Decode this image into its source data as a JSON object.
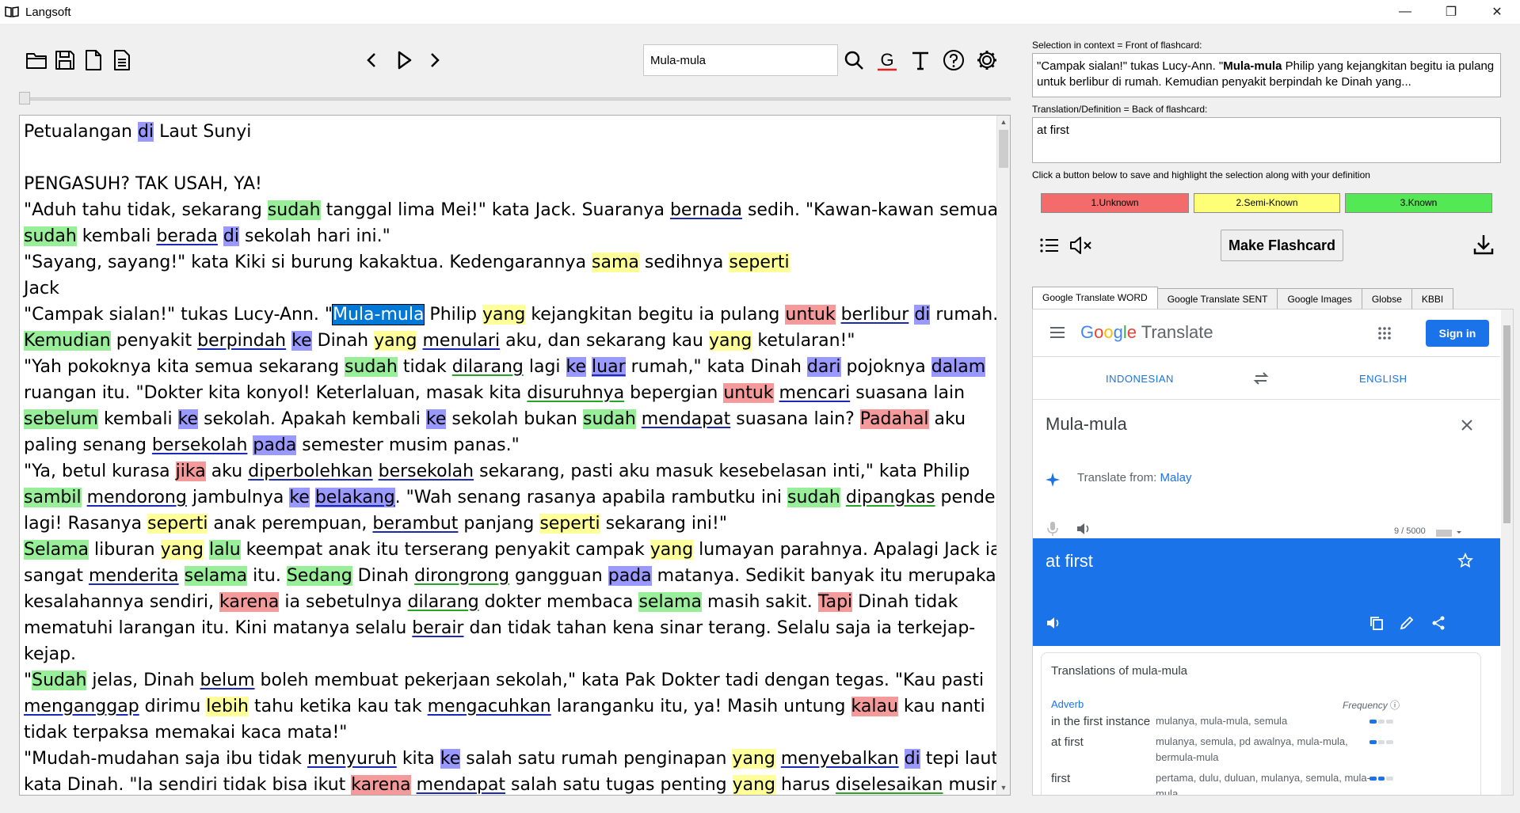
{
  "window": {
    "title": "Langsoft",
    "minimize": "—",
    "restore": "❐",
    "close": "✕"
  },
  "search": {
    "value": "Mula-mula"
  },
  "reader": {
    "lines": [
      [
        [
          "Petualangan ",
          ""
        ],
        [
          "di",
          "b"
        ],
        [
          " Laut Sunyi",
          ""
        ]
      ],
      [
        [
          "",
          ""
        ]
      ],
      [
        [
          "PENGASUH?  TAK USAH, YA!",
          ""
        ]
      ],
      [
        [
          " \"Aduh  tahu tidak, sekarang ",
          ""
        ],
        [
          "sudah",
          "k"
        ],
        [
          " tanggal lima Mei!\" kata Jack. Suaranya ",
          ""
        ],
        [
          "bernada",
          "ul"
        ],
        [
          "  sedih. \"Kawan-kawan semua",
          ""
        ]
      ],
      [
        [
          "sudah",
          "k"
        ],
        [
          " kembali ",
          ""
        ],
        [
          "berada",
          "ul"
        ],
        [
          " ",
          ""
        ],
        [
          "di",
          "b"
        ],
        [
          " sekolah hari ini.\"",
          ""
        ]
      ],
      [
        [
          "\"Sayang, sayang!\" kata Kiki si burung kakaktua. Kedengarannya ",
          ""
        ],
        [
          "sama",
          "s"
        ],
        [
          " sedihnya ",
          ""
        ],
        [
          "seperti",
          "s"
        ]
      ],
      [
        [
          "Jack",
          ""
        ]
      ],
      [
        [
          "\"Campak sialan!\" tukas Lucy-Ann. \"",
          ""
        ],
        [
          "Mula-mula",
          "sel"
        ],
        [
          " Philip ",
          ""
        ],
        [
          "yang",
          "s"
        ],
        [
          " kejangkitan begitu ia pulang ",
          ""
        ],
        [
          "untuk",
          "u"
        ],
        [
          " ",
          ""
        ],
        [
          "berlibur",
          "ul"
        ],
        [
          " ",
          ""
        ],
        [
          "di",
          "b"
        ],
        [
          " rumah.",
          ""
        ]
      ],
      [
        [
          "Kemudian",
          "k"
        ],
        [
          " penyakit ",
          ""
        ],
        [
          "berpindah",
          "ul"
        ],
        [
          " ",
          ""
        ],
        [
          "ke",
          "b"
        ],
        [
          " Dinah ",
          ""
        ],
        [
          "yang",
          "s"
        ],
        [
          " ",
          ""
        ],
        [
          "menulari",
          "ul"
        ],
        [
          " aku, dan sekarang kau ",
          ""
        ],
        [
          "yang",
          "s"
        ],
        [
          " ketularan!\"",
          ""
        ]
      ],
      [
        [
          "\"Yah  pokoknya kita semua sekarang ",
          ""
        ],
        [
          "sudah",
          "k"
        ],
        [
          " tidak ",
          ""
        ],
        [
          "dilarang",
          "ulg"
        ],
        [
          " lagi ",
          ""
        ],
        [
          "ke",
          "b"
        ],
        [
          " ",
          ""
        ],
        [
          "luar",
          "b ul"
        ],
        [
          " rumah,\" kata  Dinah ",
          ""
        ],
        [
          "dari",
          "b"
        ],
        [
          " pojoknya ",
          ""
        ],
        [
          "dalam",
          "b"
        ]
      ],
      [
        [
          "ruangan itu. \"Dokter kita konyol! Keterlaluan, masak kita ",
          ""
        ],
        [
          "disuruhnya",
          "ulg"
        ],
        [
          " bepergian ",
          ""
        ],
        [
          "untuk",
          "u"
        ],
        [
          " ",
          ""
        ],
        [
          "mencari",
          "ul"
        ],
        [
          " suasana lain",
          ""
        ]
      ],
      [
        [
          "sebelum",
          "k"
        ],
        [
          " kembali ",
          ""
        ],
        [
          "ke",
          "b"
        ],
        [
          " sekolah. Apakah kembali ",
          ""
        ],
        [
          "ke",
          "b"
        ],
        [
          " sekolah bukan ",
          ""
        ],
        [
          "sudah",
          "k"
        ],
        [
          " ",
          ""
        ],
        [
          "mendapat",
          "ul"
        ],
        [
          " suasana lain? ",
          ""
        ],
        [
          "Padahal",
          "u"
        ],
        [
          " aku",
          ""
        ]
      ],
      [
        [
          "paling senang ",
          ""
        ],
        [
          "bersekolah",
          "ul"
        ],
        [
          " ",
          ""
        ],
        [
          "pada",
          "b"
        ],
        [
          " semester musim panas.\"",
          ""
        ]
      ],
      [
        [
          "\"Ya, betul kurasa ",
          ""
        ],
        [
          "jika",
          "u"
        ],
        [
          " aku ",
          ""
        ],
        [
          "diperbolehkan",
          "ul"
        ],
        [
          " ",
          ""
        ],
        [
          "bersekolah",
          "ul"
        ],
        [
          " sekarang, pasti aku masuk  kesebelasan inti,\" kata Philip",
          ""
        ]
      ],
      [
        [
          "sambil",
          "k"
        ],
        [
          " ",
          ""
        ],
        [
          "mendorong",
          "ul"
        ],
        [
          " jambulnya ",
          ""
        ],
        [
          "ke",
          "b"
        ],
        [
          " ",
          ""
        ],
        [
          "belakang",
          "b ul"
        ],
        [
          ". \"Wah senang  rasanya apabila rambutku ini ",
          ""
        ],
        [
          "sudah",
          "k"
        ],
        [
          " ",
          ""
        ],
        [
          "dipangkas",
          "ulg"
        ],
        [
          " pendek",
          ""
        ]
      ],
      [
        [
          "lagi! Rasanya ",
          ""
        ],
        [
          "seperti",
          "s"
        ],
        [
          " anak perempuan, ",
          ""
        ],
        [
          "berambut",
          "ul"
        ],
        [
          " panjang ",
          ""
        ],
        [
          "seperti",
          "s"
        ],
        [
          " sekarang ini!\"",
          ""
        ]
      ],
      [
        [
          "Selama",
          "k"
        ],
        [
          " liburan ",
          ""
        ],
        [
          "yang",
          "s"
        ],
        [
          " ",
          ""
        ],
        [
          "lalu",
          "k"
        ],
        [
          " keempat anak itu terserang penyakit campak ",
          ""
        ],
        [
          "yang",
          "s"
        ],
        [
          " lumayan parahnya. Apalagi Jack  ia",
          ""
        ]
      ],
      [
        [
          "sangat ",
          ""
        ],
        [
          "menderita",
          "ul"
        ],
        [
          " ",
          ""
        ],
        [
          "selama",
          "k"
        ],
        [
          "  itu. ",
          ""
        ],
        [
          "Sedang",
          "k"
        ],
        [
          " Dinah ",
          ""
        ],
        [
          "dirongrong",
          "ulg"
        ],
        [
          "  gangguan ",
          ""
        ],
        [
          "pada",
          "b"
        ],
        [
          " matanya. Sedikit banyak itu merupakan",
          ""
        ]
      ],
      [
        [
          "kesalahannya sendiri, ",
          ""
        ],
        [
          "karena",
          "u"
        ],
        [
          " ia sebetulnya ",
          ""
        ],
        [
          "dilarang",
          "ulg"
        ],
        [
          " dokter membaca ",
          ""
        ],
        [
          "selama",
          "k"
        ],
        [
          " masih sakit. ",
          ""
        ],
        [
          "Tapi",
          "u"
        ],
        [
          " Dinah tidak",
          ""
        ]
      ],
      [
        [
          "mematuhi larangan itu. Kini matanya selalu ",
          ""
        ],
        [
          "berair",
          "ul"
        ],
        [
          " dan tidak tahan kena sinar terang. Selalu saja ia terkejap-",
          ""
        ]
      ],
      [
        [
          "kejap.",
          ""
        ]
      ],
      [
        [
          "\"",
          ""
        ],
        [
          "Sudah",
          "k"
        ],
        [
          " jelas, Dinah ",
          ""
        ],
        [
          "belum",
          "ul"
        ],
        [
          " boleh membuat pekerjaan sekolah,\" kata Pak Dokter tadi dengan tegas. \"Kau pasti",
          ""
        ]
      ],
      [
        [
          "menganggap",
          "ul"
        ],
        [
          " dirimu ",
          ""
        ],
        [
          "lebih",
          "s"
        ],
        [
          " tahu ketika kau tak ",
          ""
        ],
        [
          "mengacuhkan",
          "ul"
        ],
        [
          " laranganku itu, ya! Masih untung ",
          ""
        ],
        [
          "kalau",
          "u"
        ],
        [
          " kau nanti",
          ""
        ]
      ],
      [
        [
          "tidak terpaksa memakai kaca mata!\"",
          ""
        ]
      ],
      [
        [
          "\"Mudah-mudahan saja ibu tidak ",
          ""
        ],
        [
          "menyuruh",
          "ul"
        ],
        [
          " kita ",
          ""
        ],
        [
          "ke",
          "b"
        ],
        [
          " salah satu rumah penginapan ",
          ""
        ],
        [
          "yang",
          "s"
        ],
        [
          " ",
          ""
        ],
        [
          "menyebalkan",
          "ul"
        ],
        [
          " ",
          ""
        ],
        [
          "di",
          "b"
        ],
        [
          " tepi laut,\"",
          ""
        ]
      ],
      [
        [
          "kata Dinah. \"Ia sendiri tidak bisa ikut ",
          ""
        ],
        [
          "karena",
          "u"
        ],
        [
          " ",
          ""
        ],
        [
          "mendapat",
          "ul"
        ],
        [
          " salah satu tugas penting ",
          ""
        ],
        [
          "yang",
          "s"
        ],
        [
          " harus ",
          ""
        ],
        [
          "diselesaikan",
          "ulg"
        ],
        [
          " musim",
          ""
        ]
      ]
    ]
  },
  "right_panel": {
    "context_label": "Selection in context = Front of flashcard:",
    "context_before": "\"Campak sialan!\" tukas Lucy-Ann. \"",
    "context_bold": "Mula-mula",
    "context_after": " Philip yang kejangkitan begitu ia pulang untuk berlibur di rumah. Kemudian penyakit berpindah ke Dinah yang...",
    "definition_label": "Translation/Definition = Back of flashcard:",
    "definition_value": "at first",
    "instruction": "Click a button below to save and highlight the selection along with your definition",
    "buttons": {
      "unknown": "1.Unknown",
      "semi_known": "2.Semi-Known",
      "known": "3.Known",
      "make_flashcard": "Make Flashcard"
    },
    "colors": {
      "unknown": "#f36b6b",
      "semi_known": "#ffff77",
      "known": "#55e855"
    },
    "tabs": [
      "Google Translate WORD",
      "Google Translate SENT",
      "Google Images",
      "Globse",
      "KBBI"
    ]
  },
  "google_translate": {
    "logo_google": "Google",
    "logo_translate": " Translate",
    "sign_in": "Sign in",
    "source_lang": "INDONESIAN",
    "target_lang": "ENGLISH",
    "source_text": "Mula-mula",
    "translate_from_prefix": "Translate from: ",
    "translate_from_lang": "Malay",
    "char_count": "9 / 5000",
    "result": "at first",
    "translations_title_prefix": "Translations of ",
    "translations_title_word": "mula-mula",
    "pos": "Adverb",
    "frequency_label": "Frequency",
    "rows": [
      {
        "word": "in the first instance",
        "synonyms": "mulanya, mula-mula, semula"
      },
      {
        "word": "at first",
        "synonyms": "mulanya, semula, pd awalnya, mula-mula, bermula-mula"
      },
      {
        "word": "first",
        "synonyms": "pertama, dulu, duluan, mulanya, semula, mula-mula"
      }
    ]
  },
  "icons": [
    "open-folder-icon",
    "save-icon",
    "new-file-icon",
    "document-icon",
    "previous-icon",
    "play-icon",
    "next-icon",
    "search-icon",
    "google-icon",
    "text-icon",
    "help-icon",
    "settings-icon",
    "list-icon",
    "mute-icon",
    "download-icon"
  ]
}
